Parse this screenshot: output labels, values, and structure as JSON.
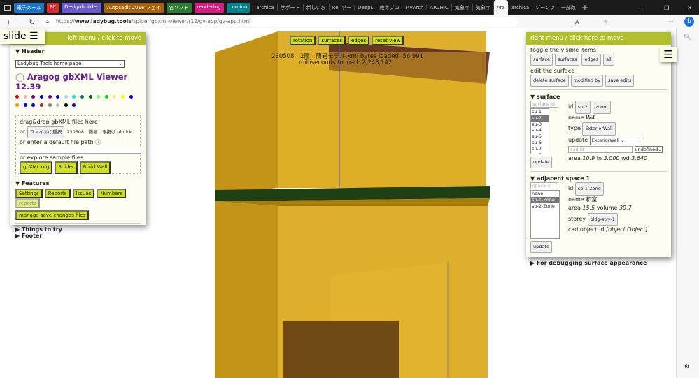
{
  "browser": {
    "favorites": [
      {
        "label": "電子メール",
        "color": "#1a73c8"
      },
      {
        "label": "PC",
        "color": "#d32f2f"
      },
      {
        "label": "Designbuilder",
        "color": "#6a5acd"
      },
      {
        "label": "Autpcadlt 2016 フェイ",
        "color": "#a8620a"
      },
      {
        "label": "各ソフト",
        "color": "#2e7d32"
      },
      {
        "label": "rendering",
        "color": "#d81b80"
      },
      {
        "label": "Lumion",
        "color": "#00838f"
      }
    ],
    "tabs": [
      "archica",
      "サポート",
      "新しいお",
      "Re: ゾー",
      "DeepL",
      "教育プロ",
      "MyArch",
      "ARCHIC",
      "気象庁",
      "気象庁",
      "Ara",
      "archica",
      "ゾーンツ",
      "一部改"
    ],
    "active_tab": "Ara",
    "url_prefix": "https://",
    "url_host": "www.ladybug.tools",
    "url_path": "/spider/gbxml-viewer/r12/gv-app/gv-app.html"
  },
  "slide": {
    "label": "slide ☰"
  },
  "left": {
    "title": "left menu / click to move",
    "header": "▼ Header",
    "select": "Ladybug Tools home page",
    "app_title": "Aragog gbXML Viewer 12.39",
    "colors": [
      "#e00000",
      "#f5b5c8",
      "#800080",
      "#0000e0",
      "#800080",
      "#0000e0",
      "#a8d8ea",
      "#00e5ee",
      "#007b7b",
      "#006400",
      "#90ee90",
      "#00e000",
      "#eee8aa",
      "#ffff00",
      "#0000e0",
      "#ff8c00",
      "#0000e0",
      "#0000e0",
      "#a52a2a",
      "#808080",
      "#c0c0c0",
      "#000000",
      "#0000e0"
    ],
    "drag": "drag&drop gbXML files here",
    "or": "or",
    "file_btn": "ファイルの選択",
    "file_name": "230508　簡易...き抜け.pln.lck",
    "path_label": "or enter a default file path",
    "explore": "or explore sample files",
    "samples": [
      "gbXML.org",
      "Spider",
      "Build Well"
    ],
    "features": "▼ Features",
    "feature_btns": [
      "Settings",
      "Reports",
      "Issues",
      "Numbers"
    ],
    "reports_disabled": "reports",
    "manage": "manage save changes files",
    "things": "▶ Things to try",
    "footer": "▶ Footer"
  },
  "center": {
    "buttons": [
      "rotation",
      "surfaces",
      "edges",
      "reset view"
    ],
    "info1": "230508　2層　簡易モデル.xml bytes loaded: 56,991",
    "info2": "milliseconds to load: 2,248,142"
  },
  "right": {
    "title": "right menu / click here to move",
    "toggle": "toggle the visible items",
    "toggle_btns": [
      "surface",
      "surfaces",
      "edges",
      "all"
    ],
    "edit": "edit the surface",
    "edit_btns": [
      "delete surface",
      "modified by",
      "save edits"
    ],
    "surface": {
      "heading": "▼ surface",
      "placeholder": "surface id",
      "items": [
        "su-1",
        "su-2",
        "su-3",
        "su-4",
        "su-5",
        "su-6",
        "su-7",
        "su-8"
      ],
      "selected": "su-2",
      "id_label": "id",
      "id": "su-2",
      "zoom": "zoom",
      "name_label": "name",
      "name": "W4",
      "type_label": "type",
      "type": "ExteriorWall",
      "update_label": "update",
      "update_value": "ExteriorWall",
      "cad_placeholder": "cad id",
      "undefined": "undefined",
      "area_label": "area",
      "area": "10.9",
      "ln_label": "ln",
      "ln": "3.000",
      "wd_label": "wd",
      "wd": "3.640",
      "update_btn": "update"
    },
    "space": {
      "heading": "▼ adjacent space 1",
      "placeholder": "space id",
      "items": [
        "none",
        "sp-1-Zone",
        "sp-2-Zone"
      ],
      "selected": "sp-1-Zone",
      "id_label": "id",
      "id": "sp-1-Zone",
      "name_label": "name",
      "name": "和室",
      "area_label": "area",
      "area": "15.5",
      "volume_label": "volume",
      "volume": "39.7",
      "storey_label": "storey",
      "storey": "bldg-stry-1",
      "cad_label": "cad object id",
      "cad": "[object Object]",
      "update_btn": "update"
    },
    "debug": "▶ For debugging surface appearance"
  }
}
